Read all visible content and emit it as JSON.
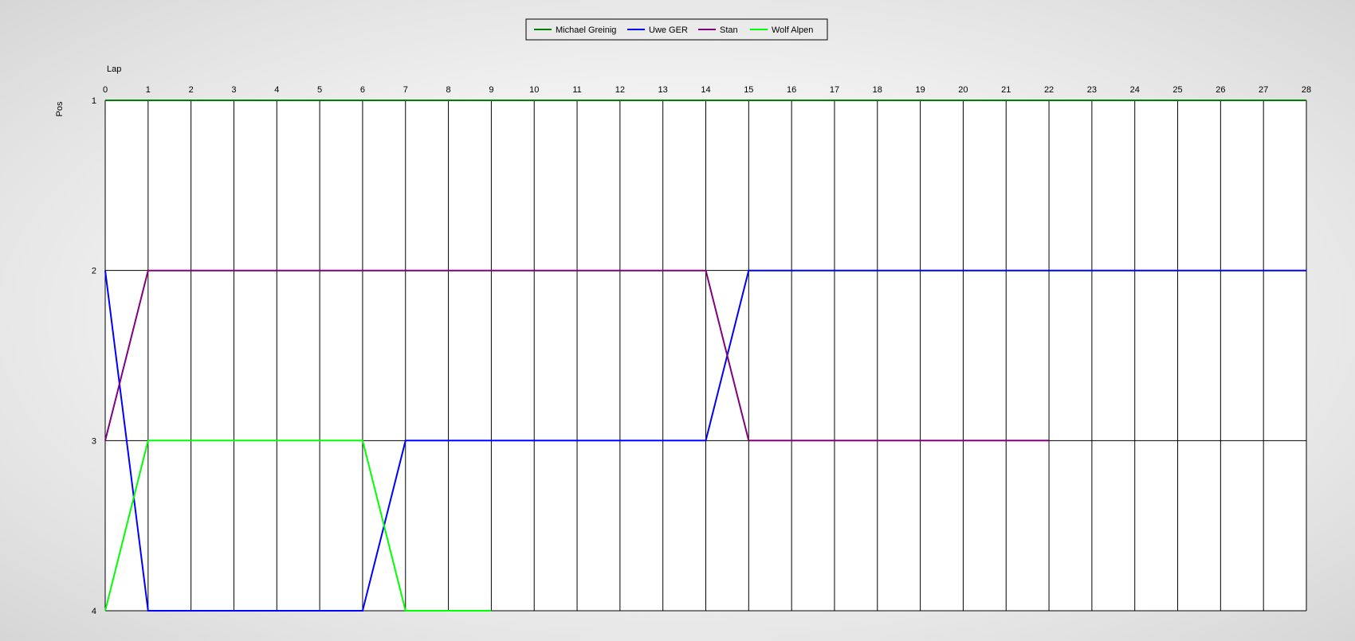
{
  "chart_data": {
    "type": "line",
    "title": "",
    "xlabel": "Lap",
    "ylabel": "Pos",
    "xlim": [
      0,
      28
    ],
    "ylim": [
      1,
      4
    ],
    "y_inverted": true,
    "x_ticks": [
      0,
      1,
      2,
      3,
      4,
      5,
      6,
      7,
      8,
      9,
      10,
      11,
      12,
      13,
      14,
      15,
      16,
      17,
      18,
      19,
      20,
      21,
      22,
      23,
      24,
      25,
      26,
      27,
      28
    ],
    "y_ticks": [
      1,
      2,
      3,
      4
    ],
    "grid": true,
    "legend_position": "top-center",
    "series": [
      {
        "name": "Michael Greinig",
        "color": "#008000",
        "x": [
          0,
          1,
          2,
          3,
          4,
          5,
          6,
          7,
          8,
          9,
          10,
          11,
          12,
          13,
          14,
          15,
          16,
          17,
          18,
          19,
          20,
          21,
          22,
          23,
          24,
          25,
          26,
          27,
          28
        ],
        "y": [
          1,
          1,
          1,
          1,
          1,
          1,
          1,
          1,
          1,
          1,
          1,
          1,
          1,
          1,
          1,
          1,
          1,
          1,
          1,
          1,
          1,
          1,
          1,
          1,
          1,
          1,
          1,
          1,
          1
        ]
      },
      {
        "name": "Uwe GER",
        "color": "#0000ff",
        "x": [
          0,
          1,
          2,
          3,
          4,
          5,
          6,
          7,
          8,
          9,
          10,
          11,
          12,
          13,
          14,
          15,
          16,
          17,
          18,
          19,
          20,
          21,
          22,
          23,
          24,
          25,
          26,
          27,
          28
        ],
        "y": [
          2,
          4,
          4,
          4,
          4,
          4,
          4,
          3,
          3,
          3,
          3,
          3,
          3,
          3,
          3,
          2,
          2,
          2,
          2,
          2,
          2,
          2,
          2,
          2,
          2,
          2,
          2,
          2,
          2
        ]
      },
      {
        "name": "Stan",
        "color": "#800080",
        "x": [
          0,
          1,
          2,
          3,
          4,
          5,
          6,
          7,
          8,
          9,
          10,
          11,
          12,
          13,
          14,
          15,
          16,
          17,
          18,
          19,
          20,
          21,
          22
        ],
        "y": [
          3,
          2,
          2,
          2,
          2,
          2,
          2,
          2,
          2,
          2,
          2,
          2,
          2,
          2,
          2,
          3,
          3,
          3,
          3,
          3,
          3,
          3,
          3
        ]
      },
      {
        "name": "Wolf Alpen",
        "color": "#00ff00",
        "x": [
          0,
          1,
          2,
          3,
          4,
          5,
          6,
          7,
          8,
          9
        ],
        "y": [
          4,
          3,
          3,
          3,
          3,
          3,
          3,
          4,
          4,
          4
        ]
      }
    ]
  }
}
